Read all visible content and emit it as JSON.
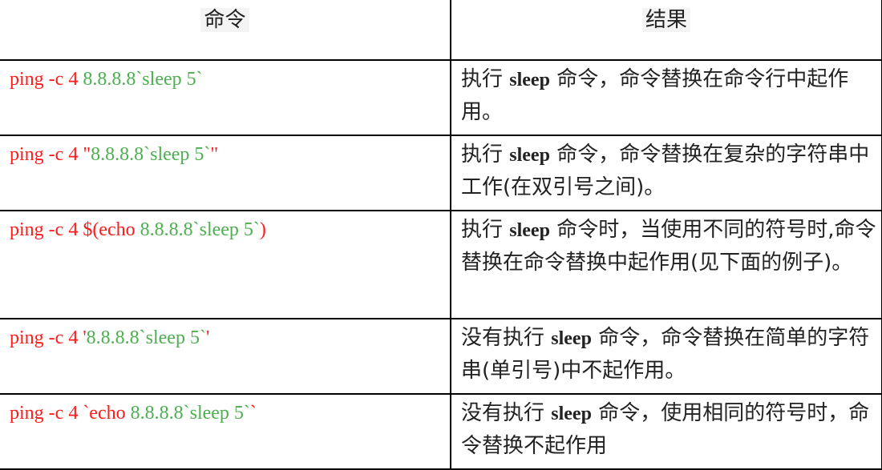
{
  "header": {
    "command": "命令",
    "result": "结果"
  },
  "rows": [
    {
      "cmd": {
        "a": "ping -c 4 ",
        "b": "8.8.8.8`sleep 5`",
        "c": ""
      },
      "res": {
        "pre": "执行 ",
        "bold": "sleep",
        "post": " 命令，命令替换在命令行中起作用。"
      }
    },
    {
      "cmd": {
        "a": "ping -c 4 \"",
        "b": "8.8.8.8`sleep 5`",
        "c": "\""
      },
      "res": {
        "pre": "执行 ",
        "bold": "sleep",
        "post": " 命令，命令替换在复杂的字符串中工作(在双引号之间)。"
      }
    },
    {
      "cmd": {
        "a": "ping -c 4 $(echo ",
        "b": "8.8.8.8`sleep 5`",
        "c": ")"
      },
      "res": {
        "pre": "执行 ",
        "bold": "sleep",
        "post": " 命令时，当使用不同的符号时,命令替换在命令替换中起作用(见下面的例子)。"
      }
    },
    {
      "cmd": {
        "a": "ping -c 4 '",
        "b": "8.8.8.8`sleep 5`",
        "c": "'"
      },
      "res": {
        "pre": "没有执行 ",
        "bold": "sleep",
        "post": " 命令，命令替换在简单的字符串(单引号)中不起作用。"
      }
    },
    {
      "cmd": {
        "a": "ping -c 4 `echo ",
        "b": "8.8.8.8`sleep 5`",
        "c": "`"
      },
      "res": {
        "pre": "没有执行 ",
        "bold": "sleep",
        "post": " 命令，使用相同的符号时，命令替换不起作用"
      }
    }
  ],
  "colors": {
    "command_text": "#ff1a1a",
    "ip_text": "#4caf50"
  }
}
